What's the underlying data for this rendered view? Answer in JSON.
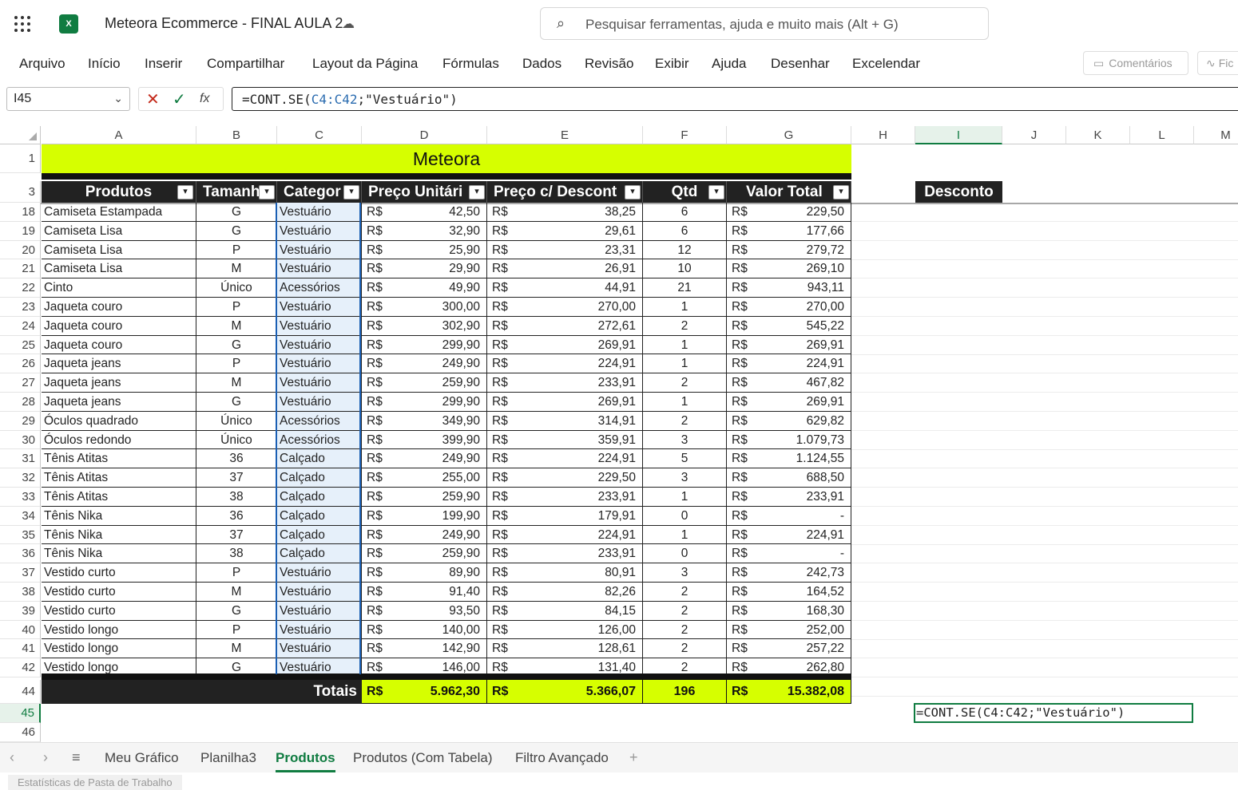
{
  "app": {
    "title": "Meteora Ecommerce - FINAL AULA 2",
    "search_placeholder": "Pesquisar ferramentas, ajuda e muito mais (Alt + G)",
    "logo_text": "X",
    "brand_color": "#107c41"
  },
  "ribbon": {
    "tabs": [
      "Arquivo",
      "Início",
      "Inserir",
      "Compartilhar",
      "Layout da Página",
      "Fórmulas",
      "Dados",
      "Revisão",
      "Exibir",
      "Ajuda",
      "Desenhar",
      "Excelendar"
    ],
    "comments_label": "Comentários",
    "share_label": "Fic"
  },
  "formula_bar": {
    "name_box": "I45",
    "formula_prefix": "=CONT.SE(",
    "formula_ref": "C4:C42",
    "formula_suffix": ";\"Vestuário\")",
    "fx_label": "fx"
  },
  "columns": [
    "A",
    "B",
    "C",
    "D",
    "E",
    "F",
    "G",
    "H",
    "I",
    "J",
    "K",
    "L",
    "M"
  ],
  "sheet": {
    "title": "Meteora",
    "headers": {
      "produtos": "Produtos",
      "tamanho": "Tamanh",
      "categoria": "Categor",
      "preco_unitario": "Preço Unitári",
      "preco_desconto": "Preço c/ Descont",
      "qtd": "Qtd",
      "valor_total": "Valor Total",
      "desconto": "Desconto"
    },
    "currency": "R$",
    "rows": [
      {
        "n": "18",
        "produto": "Camiseta Estampada",
        "tam": "G",
        "cat": "Vestuário",
        "pu": "42,50",
        "pd": "38,25",
        "qtd": "6",
        "vt": "229,50"
      },
      {
        "n": "19",
        "produto": "Camiseta Lisa",
        "tam": "G",
        "cat": "Vestuário",
        "pu": "32,90",
        "pd": "29,61",
        "qtd": "6",
        "vt": "177,66"
      },
      {
        "n": "20",
        "produto": "Camiseta Lisa",
        "tam": "P",
        "cat": "Vestuário",
        "pu": "25,90",
        "pd": "23,31",
        "qtd": "12",
        "vt": "279,72"
      },
      {
        "n": "21",
        "produto": "Camiseta Lisa",
        "tam": "M",
        "cat": "Vestuário",
        "pu": "29,90",
        "pd": "26,91",
        "qtd": "10",
        "vt": "269,10"
      },
      {
        "n": "22",
        "produto": "Cinto",
        "tam": "Único",
        "cat": "Acessórios",
        "pu": "49,90",
        "pd": "44,91",
        "qtd": "21",
        "vt": "943,11"
      },
      {
        "n": "23",
        "produto": "Jaqueta couro",
        "tam": "P",
        "cat": "Vestuário",
        "pu": "300,00",
        "pd": "270,00",
        "qtd": "1",
        "vt": "270,00"
      },
      {
        "n": "24",
        "produto": "Jaqueta couro",
        "tam": "M",
        "cat": "Vestuário",
        "pu": "302,90",
        "pd": "272,61",
        "qtd": "2",
        "vt": "545,22"
      },
      {
        "n": "25",
        "produto": "Jaqueta couro",
        "tam": "G",
        "cat": "Vestuário",
        "pu": "299,90",
        "pd": "269,91",
        "qtd": "1",
        "vt": "269,91"
      },
      {
        "n": "26",
        "produto": "Jaqueta jeans",
        "tam": "P",
        "cat": "Vestuário",
        "pu": "249,90",
        "pd": "224,91",
        "qtd": "1",
        "vt": "224,91"
      },
      {
        "n": "27",
        "produto": "Jaqueta jeans",
        "tam": "M",
        "cat": "Vestuário",
        "pu": "259,90",
        "pd": "233,91",
        "qtd": "2",
        "vt": "467,82"
      },
      {
        "n": "28",
        "produto": "Jaqueta jeans",
        "tam": "G",
        "cat": "Vestuário",
        "pu": "299,90",
        "pd": "269,91",
        "qtd": "1",
        "vt": "269,91"
      },
      {
        "n": "29",
        "produto": "Óculos quadrado",
        "tam": "Único",
        "cat": "Acessórios",
        "pu": "349,90",
        "pd": "314,91",
        "qtd": "2",
        "vt": "629,82"
      },
      {
        "n": "30",
        "produto": "Óculos redondo",
        "tam": "Único",
        "cat": "Acessórios",
        "pu": "399,90",
        "pd": "359,91",
        "qtd": "3",
        "vt": "1.079,73"
      },
      {
        "n": "31",
        "produto": "Tênis Atitas",
        "tam": "36",
        "cat": "Calçado",
        "pu": "249,90",
        "pd": "224,91",
        "qtd": "5",
        "vt": "1.124,55"
      },
      {
        "n": "32",
        "produto": "Tênis Atitas",
        "tam": "37",
        "cat": "Calçado",
        "pu": "255,00",
        "pd": "229,50",
        "qtd": "3",
        "vt": "688,50"
      },
      {
        "n": "33",
        "produto": "Tênis Atitas",
        "tam": "38",
        "cat": "Calçado",
        "pu": "259,90",
        "pd": "233,91",
        "qtd": "1",
        "vt": "233,91"
      },
      {
        "n": "34",
        "produto": "Tênis Nika",
        "tam": "36",
        "cat": "Calçado",
        "pu": "199,90",
        "pd": "179,91",
        "qtd": "0",
        "vt": "-"
      },
      {
        "n": "35",
        "produto": "Tênis Nika",
        "tam": "37",
        "cat": "Calçado",
        "pu": "249,90",
        "pd": "224,91",
        "qtd": "1",
        "vt": "224,91"
      },
      {
        "n": "36",
        "produto": "Tênis Nika",
        "tam": "38",
        "cat": "Calçado",
        "pu": "259,90",
        "pd": "233,91",
        "qtd": "0",
        "vt": "-"
      },
      {
        "n": "37",
        "produto": "Vestido curto",
        "tam": "P",
        "cat": "Vestuário",
        "pu": "89,90",
        "pd": "80,91",
        "qtd": "3",
        "vt": "242,73"
      },
      {
        "n": "38",
        "produto": "Vestido curto",
        "tam": "M",
        "cat": "Vestuário",
        "pu": "91,40",
        "pd": "82,26",
        "qtd": "2",
        "vt": "164,52"
      },
      {
        "n": "39",
        "produto": "Vestido curto",
        "tam": "G",
        "cat": "Vestuário",
        "pu": "93,50",
        "pd": "84,15",
        "qtd": "2",
        "vt": "168,30"
      },
      {
        "n": "40",
        "produto": "Vestido longo",
        "tam": "P",
        "cat": "Vestuário",
        "pu": "140,00",
        "pd": "126,00",
        "qtd": "2",
        "vt": "252,00"
      },
      {
        "n": "41",
        "produto": "Vestido longo",
        "tam": "M",
        "cat": "Vestuário",
        "pu": "142,90",
        "pd": "128,61",
        "qtd": "2",
        "vt": "257,22"
      },
      {
        "n": "42",
        "produto": "Vestido longo",
        "tam": "G",
        "cat": "Vestuário",
        "pu": "146,00",
        "pd": "131,40",
        "qtd": "2",
        "vt": "262,80"
      }
    ],
    "totals": {
      "label": "Totais",
      "preco_unitario": "5.962,30",
      "preco_desconto": "5.366,07",
      "qtd": "196",
      "valor_total": "15.382,08"
    },
    "editing_cell_text": "=CONT.SE(C4:C42;\"Vestuário\")",
    "row_numbers": {
      "r1": "1",
      "r3": "3",
      "r44": "44",
      "r45": "45",
      "r46": "46"
    },
    "accent_yellow": "#d6ff00"
  },
  "sheet_tabs": {
    "tabs": [
      "Meu Gráfico",
      "Planilha3",
      "Produtos",
      "Produtos (Com Tabela)",
      "Filtro Avançado"
    ],
    "active": "Produtos",
    "add_label": "+"
  },
  "status": {
    "workbook_stats": "Estatísticas de Pasta de Trabalho"
  }
}
